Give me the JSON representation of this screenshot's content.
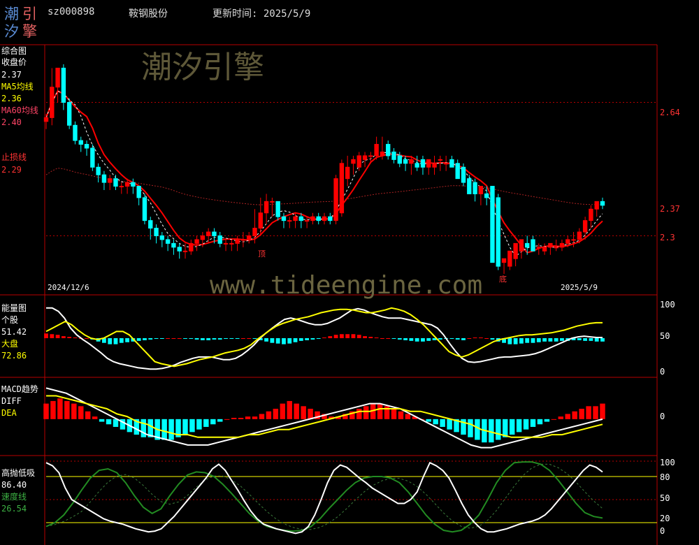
{
  "header": {
    "code": "sz000898",
    "stock_name": "鞍钢股份",
    "update_label": "更新时间: 2025/5/9",
    "logo_chars": [
      "潮",
      "引",
      "汐",
      "擎"
    ]
  },
  "watermarks": {
    "brand": "潮汐引擎",
    "url": "www.tideengine.com"
  },
  "colors": {
    "up": "#ff0000",
    "down": "#00ffff",
    "ma60": "#ff0000",
    "ma5": "#ffffff",
    "white_line": "#ffffff",
    "yellow_line": "#ffff00",
    "green_line": "#228b22",
    "axis": "#b80000",
    "label_ma5": "#ffff00",
    "label_ma60": "#ff4466",
    "label_stop": "#ff3333",
    "label_green": "#3cb043"
  },
  "panels": {
    "main": {
      "title": "综合图",
      "close_label": "收盘价",
      "close_value": "2.37",
      "ma5_label": "MA5均线",
      "ma5_value": "2.36",
      "ma60_label": "MA60均线",
      "ma60_value": "2.40",
      "stop_label": "止损线",
      "stop_value": "2.29",
      "date_start": "2024/12/6",
      "date_end": "2025/5/9",
      "marker_top": "顶",
      "marker_bottom": "底"
    },
    "energy": {
      "title": "能量图",
      "sub": "个股",
      "val1": "51.42",
      "label2": "大盘",
      "val2": "72.86"
    },
    "macd": {
      "title": "MACD趋势",
      "diff_label": "DIFF",
      "dea_label": "DEA"
    },
    "gaopao": {
      "title": "高抛低吸",
      "val1": "86.40",
      "label2": "速度线",
      "val2": "26.54"
    }
  },
  "chart_data": [
    {
      "type": "candlestick",
      "title": "综合图",
      "x": [
        "2024/12/6",
        "",
        "",
        "",
        "",
        "",
        "",
        "",
        "",
        "",
        "",
        "",
        "",
        "",
        "",
        "",
        "",
        "",
        "",
        "",
        "",
        "",
        "",
        "",
        "",
        "",
        "",
        "",
        "",
        "",
        "",
        "",
        "",
        "",
        "",
        "",
        "",
        "",
        "",
        "",
        "",
        "",
        "",
        "",
        "",
        "",
        "",
        "",
        "",
        "",
        "",
        "",
        "",
        "",
        "",
        "",
        "",
        "",
        "",
        "",
        "",
        "",
        "",
        "",
        "",
        "",
        "",
        "",
        "",
        "",
        "",
        "",
        "",
        "",
        "",
        "",
        "",
        "",
        "",
        "",
        "",
        "",
        "",
        "",
        "2025/5/9"
      ],
      "open": [
        2.59,
        2.6,
        2.68,
        2.73,
        2.64,
        2.58,
        2.54,
        2.53,
        2.52,
        2.47,
        2.45,
        2.43,
        2.44,
        2.42,
        2.42,
        2.43,
        2.42,
        2.39,
        2.33,
        2.31,
        2.29,
        2.28,
        2.27,
        2.26,
        2.25,
        2.25,
        2.27,
        2.28,
        2.29,
        2.3,
        2.29,
        2.27,
        2.27,
        2.27,
        2.28,
        2.28,
        2.29,
        2.31,
        2.35,
        2.38,
        2.38,
        2.34,
        2.33,
        2.33,
        2.34,
        2.33,
        2.33,
        2.34,
        2.33,
        2.34,
        2.33,
        2.35,
        2.44,
        2.48,
        2.47,
        2.49,
        2.5,
        2.5,
        2.5,
        2.53,
        2.51,
        2.5,
        2.49,
        2.48,
        2.48,
        2.49,
        2.47,
        2.47,
        2.49,
        2.48,
        2.49,
        2.48,
        2.47,
        2.44,
        2.43,
        2.4,
        2.4,
        2.42,
        2.39,
        2.22,
        2.21,
        2.23,
        2.25,
        2.27,
        2.28,
        2.26,
        2.25,
        2.26,
        2.26,
        2.26,
        2.27,
        2.28,
        2.28,
        2.3,
        2.33,
        2.36,
        2.38
      ],
      "high": [
        2.61,
        2.73,
        2.73,
        2.74,
        2.65,
        2.59,
        2.55,
        2.54,
        2.53,
        2.48,
        2.46,
        2.45,
        2.45,
        2.43,
        2.44,
        2.44,
        2.42,
        2.4,
        2.34,
        2.32,
        2.3,
        2.29,
        2.28,
        2.27,
        2.27,
        2.28,
        2.29,
        2.3,
        2.31,
        2.31,
        2.3,
        2.28,
        2.28,
        2.29,
        2.3,
        2.3,
        2.36,
        2.39,
        2.4,
        2.39,
        2.38,
        2.35,
        2.34,
        2.35,
        2.35,
        2.34,
        2.35,
        2.35,
        2.35,
        2.35,
        2.45,
        2.49,
        2.5,
        2.5,
        2.51,
        2.51,
        2.51,
        2.55,
        2.55,
        2.54,
        2.52,
        2.51,
        2.5,
        2.5,
        2.5,
        2.5,
        2.49,
        2.5,
        2.5,
        2.5,
        2.5,
        2.49,
        2.48,
        2.45,
        2.44,
        2.42,
        2.42,
        2.42,
        2.4,
        2.23,
        2.24,
        2.26,
        2.28,
        2.29,
        2.29,
        2.27,
        2.27,
        2.27,
        2.28,
        2.28,
        2.29,
        2.3,
        2.31,
        2.34,
        2.37,
        2.38,
        2.39
      ],
      "low": [
        2.57,
        2.58,
        2.64,
        2.62,
        2.57,
        2.53,
        2.51,
        2.5,
        2.46,
        2.43,
        2.41,
        2.41,
        2.41,
        2.4,
        2.4,
        2.4,
        2.37,
        2.32,
        2.28,
        2.27,
        2.26,
        2.25,
        2.24,
        2.23,
        2.23,
        2.24,
        2.25,
        2.26,
        2.27,
        2.27,
        2.26,
        2.25,
        2.25,
        2.25,
        2.26,
        2.27,
        2.27,
        2.29,
        2.32,
        2.34,
        2.33,
        2.31,
        2.31,
        2.31,
        2.31,
        2.31,
        2.32,
        2.32,
        2.32,
        2.32,
        2.32,
        2.34,
        2.42,
        2.45,
        2.46,
        2.47,
        2.48,
        2.49,
        2.49,
        2.49,
        2.48,
        2.47,
        2.46,
        2.45,
        2.46,
        2.45,
        2.45,
        2.45,
        2.46,
        2.46,
        2.47,
        2.45,
        2.42,
        2.4,
        2.38,
        2.37,
        2.37,
        2.38,
        2.2,
        2.19,
        2.2,
        2.21,
        2.23,
        2.24,
        2.25,
        2.24,
        2.24,
        2.24,
        2.25,
        2.25,
        2.26,
        2.26,
        2.27,
        2.28,
        2.31,
        2.34,
        2.36
      ],
      "close": [
        2.6,
        2.68,
        2.73,
        2.64,
        2.58,
        2.54,
        2.53,
        2.52,
        2.47,
        2.45,
        2.43,
        2.44,
        2.42,
        2.42,
        2.43,
        2.42,
        2.39,
        2.33,
        2.31,
        2.29,
        2.28,
        2.27,
        2.26,
        2.25,
        2.25,
        2.27,
        2.28,
        2.29,
        2.3,
        2.29,
        2.27,
        2.27,
        2.27,
        2.28,
        2.28,
        2.29,
        2.31,
        2.35,
        2.38,
        2.38,
        2.34,
        2.33,
        2.33,
        2.34,
        2.33,
        2.33,
        2.34,
        2.33,
        2.34,
        2.33,
        2.44,
        2.48,
        2.47,
        2.49,
        2.5,
        2.5,
        2.5,
        2.53,
        2.51,
        2.5,
        2.49,
        2.48,
        2.48,
        2.49,
        2.47,
        2.47,
        2.49,
        2.48,
        2.49,
        2.48,
        2.47,
        2.44,
        2.43,
        2.4,
        2.4,
        2.42,
        2.39,
        2.22,
        2.21,
        2.23,
        2.25,
        2.27,
        2.28,
        2.26,
        2.25,
        2.26,
        2.26,
        2.27,
        2.26,
        2.27,
        2.28,
        2.28,
        2.3,
        2.33,
        2.36,
        2.38,
        2.37
      ],
      "ma60_level": 2.4,
      "stop_loss_level": 2.29,
      "right_axis_labels": [
        "2.64",
        "2.37",
        "2.3"
      ],
      "ylim": [
        2.19,
        2.74
      ]
    },
    {
      "type": "bar+line",
      "title": "能量图",
      "series_names": [
        "个股",
        "大盘"
      ],
      "bars": [
        7,
        6,
        5,
        3,
        2,
        1,
        0,
        0,
        -2,
        -5,
        -7,
        -9,
        -9,
        -7,
        -6,
        -5,
        -4,
        -3,
        -2,
        -1,
        -1,
        0,
        0,
        0,
        -1,
        -1,
        -2,
        -3,
        -3,
        -2,
        -2,
        -1,
        -1,
        -1,
        0,
        0,
        -1,
        -3,
        -5,
        -7,
        -8,
        -9,
        -8,
        -6,
        -4,
        -3,
        -2,
        -1,
        1,
        3,
        5,
        6,
        6,
        6,
        5,
        3,
        2,
        1,
        0,
        0,
        -1,
        -2,
        -3,
        -4,
        -5,
        -5,
        -4,
        -3,
        -2,
        -1,
        -1,
        -2,
        -3,
        0,
        1,
        1,
        0,
        -2,
        -5,
        -7,
        -9,
        -9,
        -8,
        -7,
        -7,
        -6,
        -5,
        -5,
        -5,
        -4,
        -4,
        -3,
        -3,
        -4,
        -4,
        -5,
        -5
      ],
      "white_line": [
        95,
        95,
        90,
        80,
        65,
        55,
        48,
        42,
        35,
        28,
        20,
        15,
        12,
        10,
        8,
        6,
        5,
        4,
        4,
        5,
        7,
        10,
        14,
        17,
        20,
        22,
        22,
        22,
        20,
        18,
        18,
        20,
        25,
        32,
        40,
        50,
        58,
        65,
        72,
        78,
        80,
        78,
        75,
        72,
        70,
        70,
        72,
        76,
        80,
        86,
        92,
        94,
        92,
        88,
        85,
        82,
        80,
        80,
        80,
        78,
        76,
        74,
        72,
        70,
        65,
        55,
        42,
        30,
        20,
        15,
        14,
        15,
        17,
        19,
        21,
        22,
        22,
        23,
        24,
        25,
        27,
        30,
        34,
        38,
        42,
        46,
        50,
        52,
        53,
        52,
        51,
        51
      ],
      "yellow_line": [
        60,
        65,
        70,
        75,
        70,
        62,
        55,
        50,
        48,
        50,
        55,
        60,
        60,
        55,
        45,
        35,
        25,
        15,
        12,
        10,
        8,
        10,
        12,
        15,
        18,
        20,
        22,
        25,
        28,
        30,
        32,
        35,
        40,
        48,
        55,
        62,
        68,
        72,
        75,
        78,
        80,
        82,
        85,
        88,
        90,
        92,
        93,
        93,
        92,
        90,
        88,
        88,
        90,
        92,
        95,
        93,
        90,
        85,
        78,
        70,
        60,
        50,
        40,
        30,
        25,
        22,
        25,
        30,
        35,
        40,
        45,
        48,
        50,
        52,
        54,
        55,
        55,
        56,
        57,
        58,
        60,
        62,
        65,
        68,
        70,
        72,
        73,
        73
      ],
      "right_axis_labels": [
        "100",
        "50",
        "0"
      ],
      "ylim": [
        0,
        100
      ]
    },
    {
      "type": "bar+line",
      "title": "MACD趋势",
      "series_names": [
        "DIFF",
        "DEA"
      ],
      "bars": [
        0.06,
        0.07,
        0.08,
        0.07,
        0.06,
        0.05,
        0.03,
        0.01,
        -0.01,
        -0.02,
        -0.03,
        -0.04,
        -0.05,
        -0.06,
        -0.07,
        -0.07,
        -0.08,
        -0.08,
        -0.08,
        -0.07,
        -0.06,
        -0.05,
        -0.04,
        -0.03,
        -0.02,
        -0.01,
        0,
        0.005,
        0.005,
        0.01,
        0.01,
        0.02,
        0.03,
        0.04,
        0.06,
        0.07,
        0.06,
        0.05,
        0.04,
        0.03,
        0.02,
        0.01,
        0.01,
        0.02,
        0.03,
        0.04,
        0.05,
        0.06,
        0.06,
        0.05,
        0.04,
        0.03,
        0.02,
        0.01,
        0,
        -0.01,
        -0.02,
        -0.03,
        -0.04,
        -0.05,
        -0.06,
        -0.07,
        -0.08,
        -0.09,
        -0.09,
        -0.08,
        -0.07,
        -0.06,
        -0.05,
        -0.04,
        -0.03,
        -0.02,
        -0.01,
        0,
        0.01,
        0.02,
        0.03,
        0.04,
        0.05,
        0.05,
        0.06
      ],
      "white_line": [
        0.12,
        0.11,
        0.1,
        0.08,
        0.06,
        0.04,
        0.02,
        0,
        -0.02,
        -0.04,
        -0.06,
        -0.07,
        -0.08,
        -0.09,
        -0.1,
        -0.1,
        -0.1,
        -0.09,
        -0.08,
        -0.07,
        -0.06,
        -0.05,
        -0.04,
        -0.03,
        -0.02,
        -0.01,
        0,
        0.01,
        0.02,
        0.03,
        0.04,
        0.05,
        0.06,
        0.06,
        0.05,
        0.04,
        0.02,
        0,
        -0.02,
        -0.04,
        -0.06,
        -0.08,
        -0.1,
        -0.11,
        -0.11,
        -0.1,
        -0.09,
        -0.08,
        -0.07,
        -0.06,
        -0.05,
        -0.04,
        -0.03,
        -0.02,
        -0.01,
        0
      ],
      "yellow_line": [
        0.09,
        0.09,
        0.08,
        0.07,
        0.06,
        0.05,
        0.04,
        0.02,
        0.01,
        -0.01,
        -0.02,
        -0.04,
        -0.05,
        -0.06,
        -0.06,
        -0.07,
        -0.07,
        -0.07,
        -0.07,
        -0.07,
        -0.06,
        -0.06,
        -0.05,
        -0.04,
        -0.04,
        -0.03,
        -0.02,
        -0.01,
        0,
        0.01,
        0.02,
        0.03,
        0.03,
        0.04,
        0.04,
        0.04,
        0.03,
        0.03,
        0.02,
        0.01,
        0,
        -0.01,
        -0.02,
        -0.04,
        -0.05,
        -0.06,
        -0.07,
        -0.07,
        -0.07,
        -0.07,
        -0.06,
        -0.06,
        -0.05,
        -0.04,
        -0.03,
        -0.02
      ],
      "right_axis_labels": [
        "0"
      ],
      "ylim": [
        -0.13,
        0.14
      ]
    },
    {
      "type": "line",
      "title": "高抛低吸",
      "series_names": [
        "高抛低吸",
        "速度线"
      ],
      "white_line": [
        98,
        94,
        85,
        65,
        50,
        45,
        40,
        35,
        30,
        25,
        22,
        20,
        18,
        15,
        12,
        10,
        8,
        9,
        12,
        20,
        28,
        38,
        48,
        58,
        68,
        78,
        90,
        96,
        88,
        75,
        62,
        48,
        35,
        25,
        18,
        15,
        12,
        10,
        8,
        6,
        8,
        15,
        30,
        50,
        72,
        88,
        95,
        92,
        85,
        78,
        72,
        65,
        60,
        55,
        50,
        45,
        45,
        50,
        60,
        80,
        98,
        94,
        88,
        78,
        62,
        45,
        30,
        20,
        12,
        8,
        8,
        10,
        12,
        15,
        18,
        20,
        22,
        25,
        30,
        38,
        48,
        58,
        68,
        78,
        88,
        95,
        92,
        86
      ],
      "green_line": [
        15,
        20,
        30,
        45,
        62,
        78,
        88,
        90,
        85,
        72,
        55,
        40,
        32,
        38,
        55,
        70,
        82,
        86,
        85,
        80,
        70,
        58,
        45,
        32,
        22,
        15,
        12,
        10,
        9,
        10,
        15,
        25,
        38,
        50,
        62,
        72,
        78,
        80,
        80,
        78,
        72,
        60,
        45,
        30,
        18,
        10,
        8,
        10,
        18,
        30,
        50,
        72,
        88,
        98,
        99,
        99,
        96,
        88,
        75,
        60,
        45,
        33,
        28,
        26
      ],
      "right_axis_labels": [
        "100",
        "80",
        "50",
        "20",
        "0"
      ],
      "ylim": [
        0,
        100
      ]
    }
  ]
}
